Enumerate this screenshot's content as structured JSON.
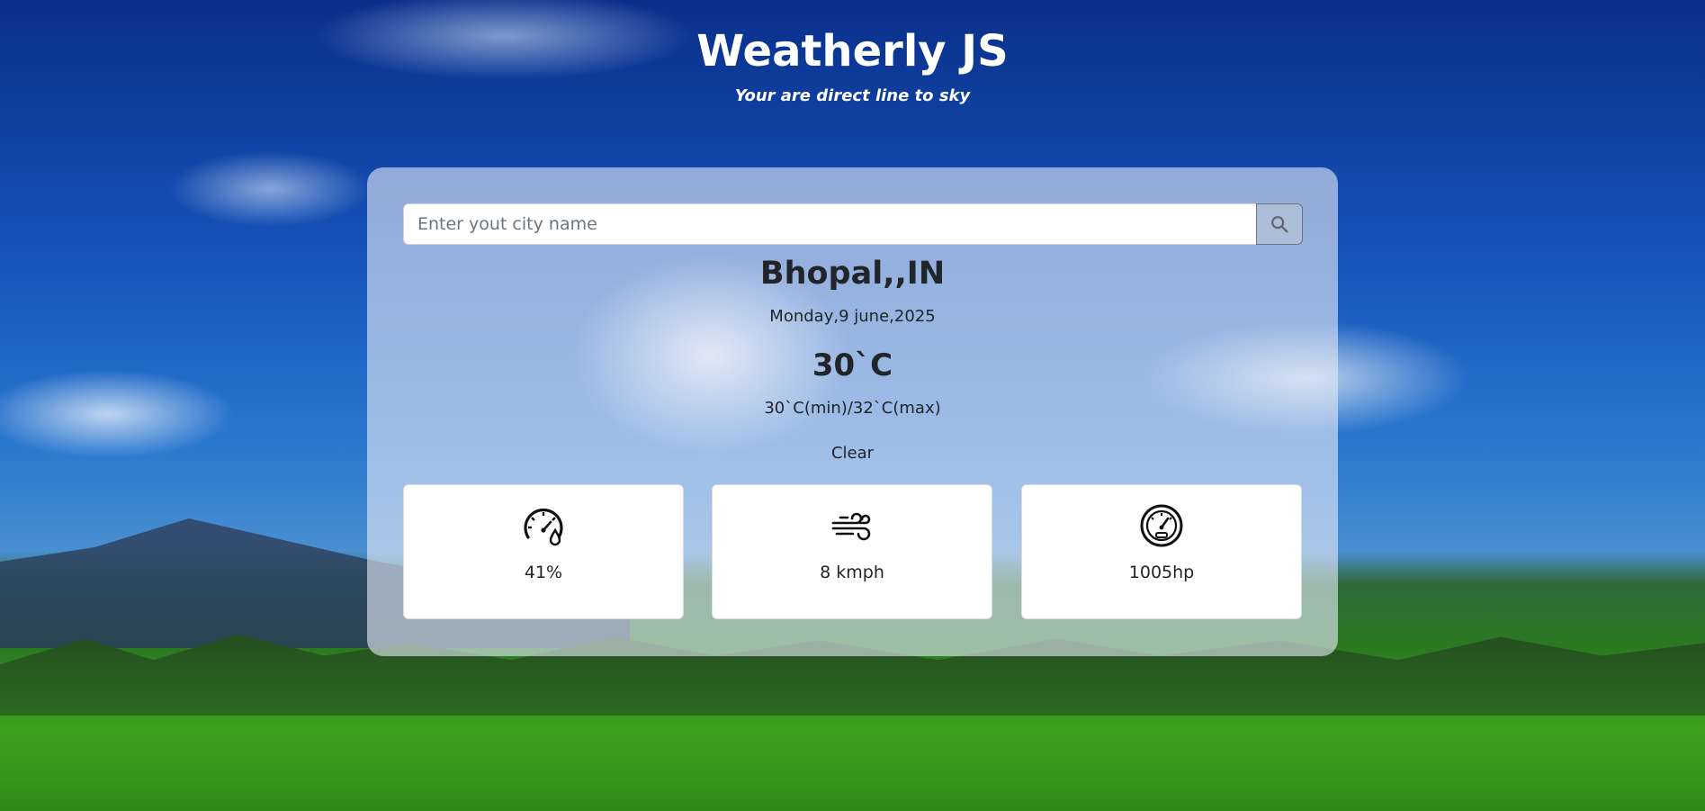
{
  "header": {
    "title": "Weatherly JS",
    "subtitle": "Your are direct line to sky"
  },
  "search": {
    "placeholder": "Enter yout city name",
    "value": "",
    "button_icon": "search-icon"
  },
  "weather": {
    "location": "Bhopal,,IN",
    "date": "Monday,9 june,2025",
    "temperature": "30`C",
    "min_max": "30`C(min)/32`C(max)",
    "condition": "Clear"
  },
  "stats": [
    {
      "icon": "humidity-gauge-icon",
      "value": "41%"
    },
    {
      "icon": "wind-icon",
      "value": "8 kmph"
    },
    {
      "icon": "pressure-gauge-icon",
      "value": "1005hp"
    }
  ]
}
